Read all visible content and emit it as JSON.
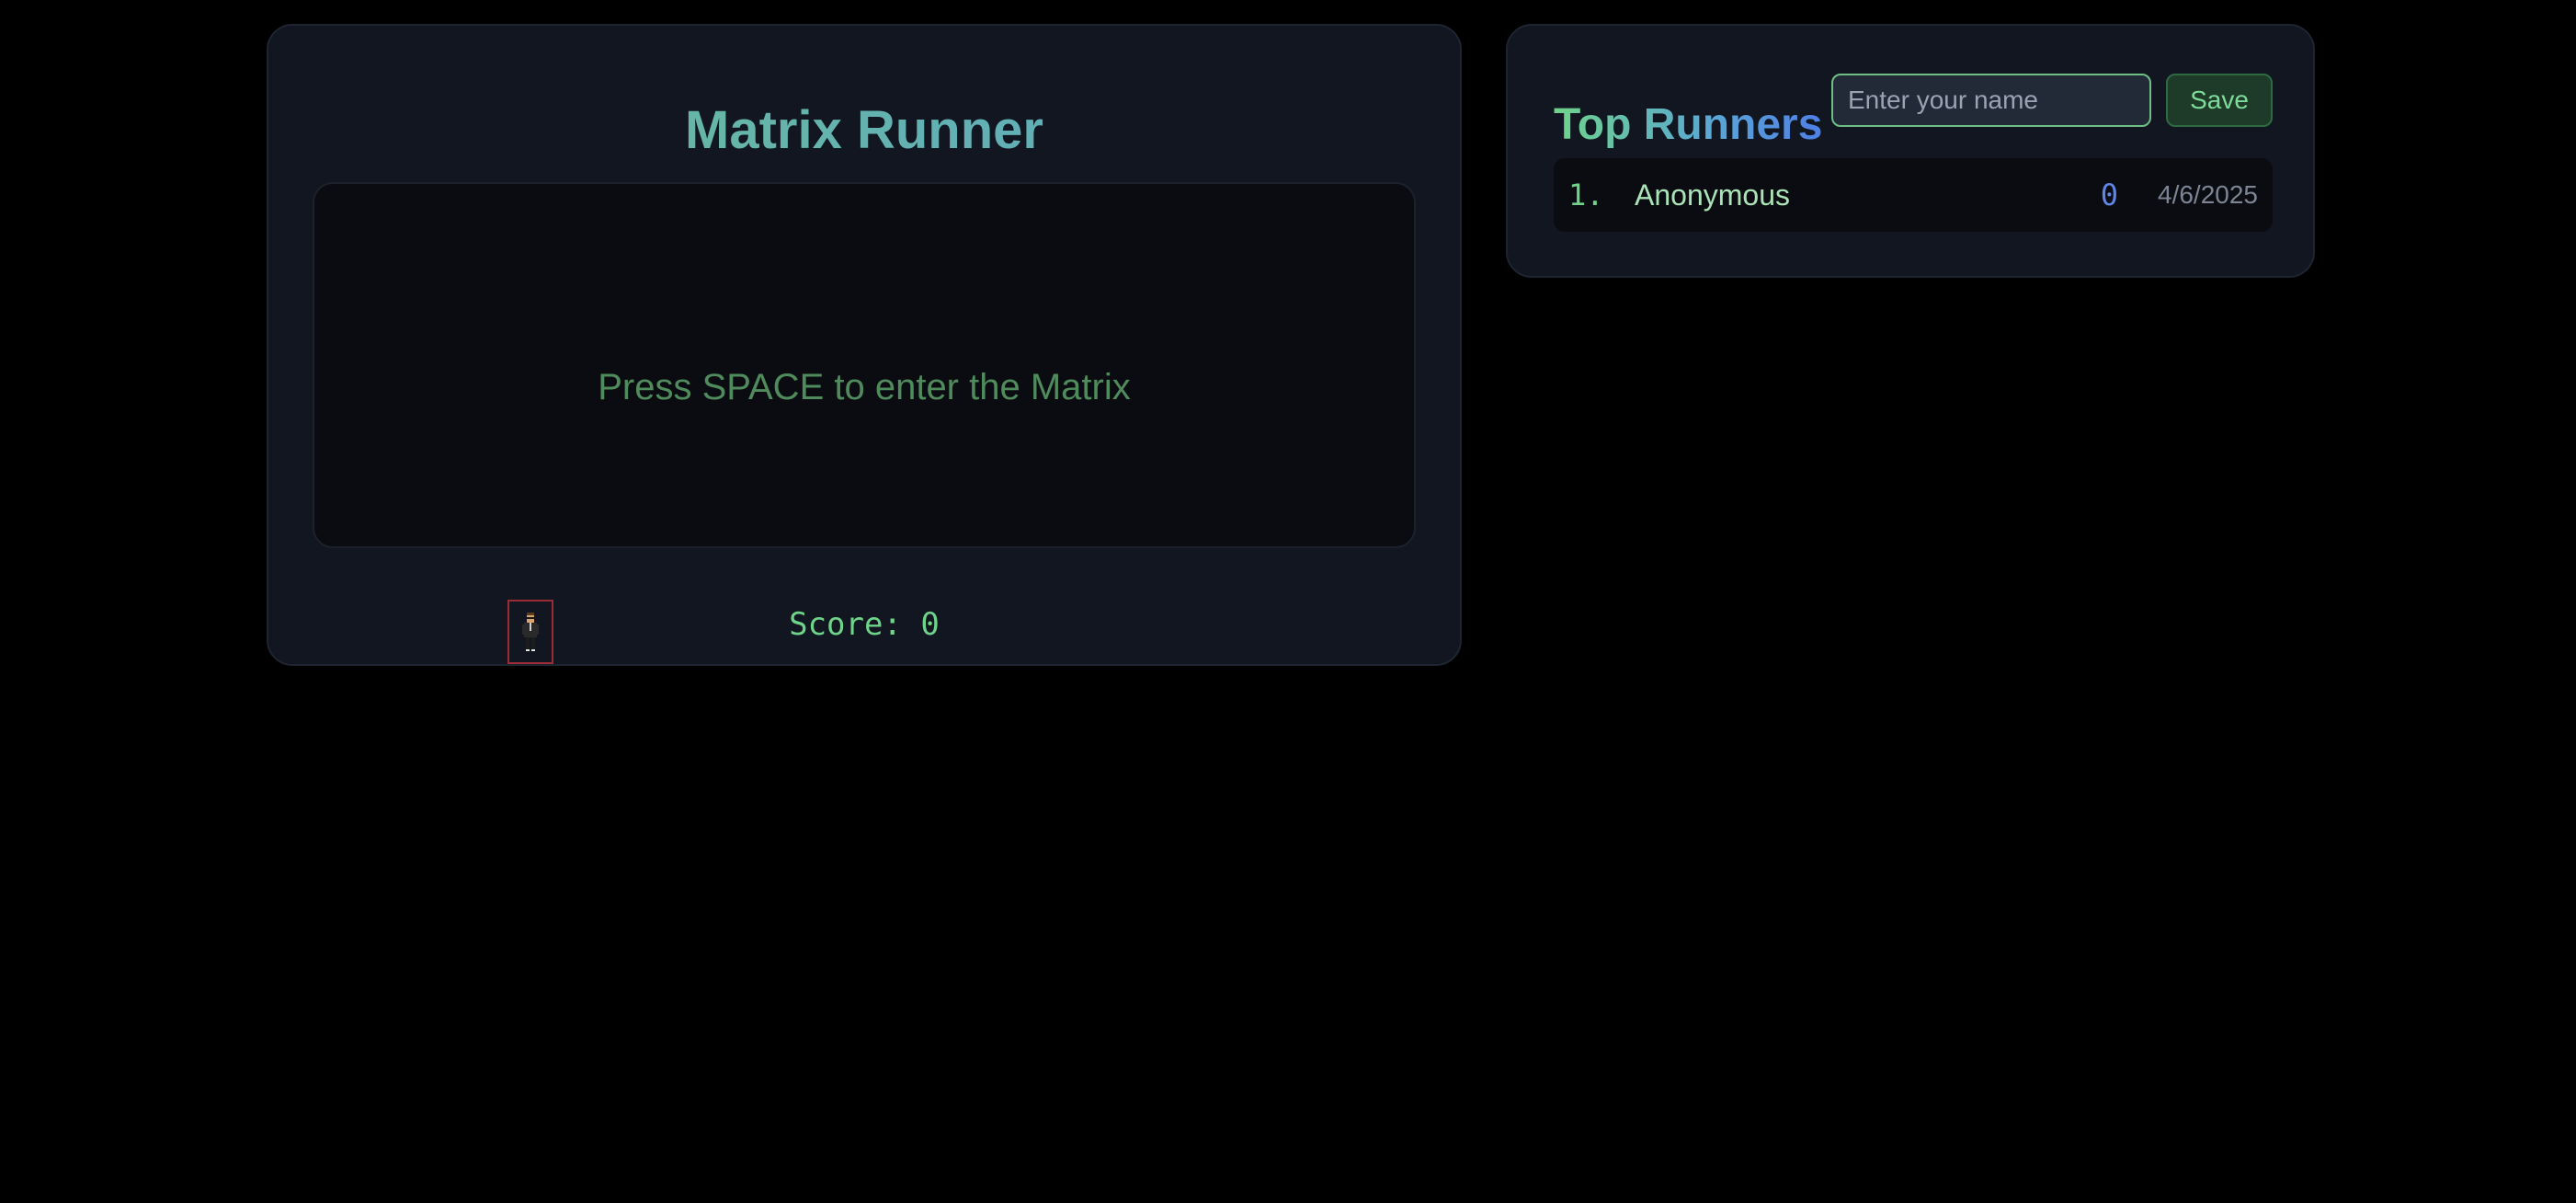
{
  "game": {
    "title": "Matrix Runner",
    "prompt": "Press SPACE to enter the Matrix",
    "score_text": "Score: 0"
  },
  "leaderboard": {
    "title": "Top Runners",
    "name_input": {
      "placeholder": "Enter your name",
      "value": ""
    },
    "save_label": "Save",
    "entries": [
      {
        "rank": "1.",
        "name": "Anonymous",
        "score": "0",
        "date": "4/6/2025"
      }
    ]
  },
  "icons": {
    "runner": "runner-sprite-icon"
  },
  "colors": {
    "background": "#000000",
    "panel": "#111620",
    "canvas": "#0a0c11",
    "accent_green": "#6fd38a",
    "accent_blue": "#5f86e6",
    "prompt_green": "#4f8b5c",
    "hitbox_red": "#9b2b34"
  }
}
